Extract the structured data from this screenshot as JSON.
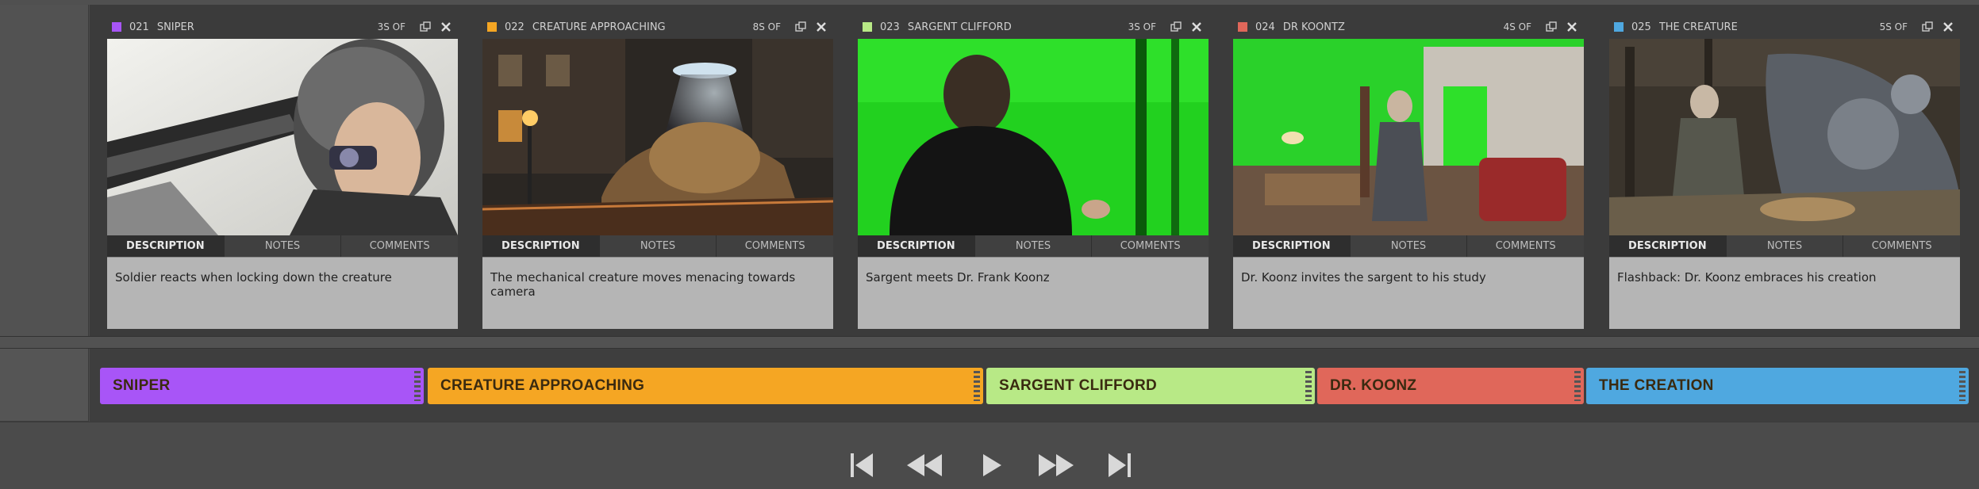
{
  "colors": {
    "sniper": "#a855f7",
    "creature": "#f5a623",
    "sargent": "#b8e986",
    "koontz": "#e0675a",
    "creation": "#4fa8e0"
  },
  "tabs": [
    "DESCRIPTION",
    "NOTES",
    "COMMENTS"
  ],
  "shots": [
    {
      "num": "021",
      "title": "SNIPER",
      "duration": "3S OF",
      "description": "Soldier reacts when locking down the creature"
    },
    {
      "num": "022",
      "title": "CREATURE APPROACHING",
      "duration": "8S OF",
      "description": "The mechanical creature moves menacing towards camera"
    },
    {
      "num": "023",
      "title": "SARGENT CLIFFORD",
      "duration": "3S OF",
      "description": "Sargent meets Dr. Frank Koonz"
    },
    {
      "num": "024",
      "title": "DR KOONTZ",
      "duration": "4S OF",
      "description": "Dr. Koonz invites the sargent to his study"
    },
    {
      "num": "025",
      "title": "THE CREATURE",
      "duration": "5S OF",
      "description": "Flashback: Dr. Koonz embraces his creation"
    }
  ],
  "timeline": [
    {
      "label": "SNIPER"
    },
    {
      "label": "CREATURE APPROACHING"
    },
    {
      "label": "SARGENT CLIFFORD"
    },
    {
      "label": "DR. KOONZ"
    },
    {
      "label": "THE CREATION"
    }
  ],
  "transport": [
    "skip-to-start-icon",
    "rewind-icon",
    "play-icon",
    "fast-forward-icon",
    "skip-to-end-icon"
  ]
}
